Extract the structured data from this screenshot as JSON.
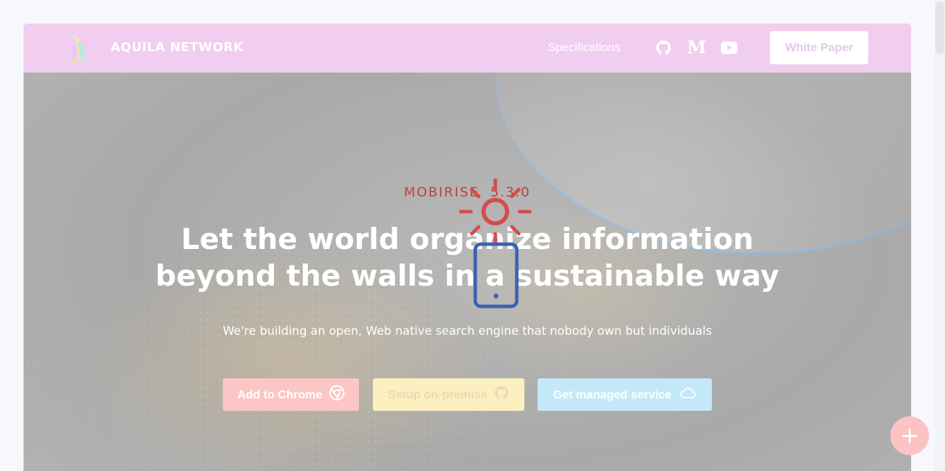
{
  "navbar": {
    "brand": "AQUILA NETWORK",
    "links": [
      {
        "label": "Specifications"
      }
    ],
    "icons": [
      "github-icon",
      "medium-icon",
      "youtube-icon"
    ],
    "medium_glyph": "M",
    "cta_label": "White Paper",
    "background": "#f1cdef"
  },
  "hero": {
    "eyebrow": "MOBIRISE  5.3.0",
    "title_line1": "Let the world organize information",
    "title_line2": "beyond the walls in a sustainable way",
    "subtitle": "We're building an open, Web native search engine that nobody own but individuals",
    "buttons": [
      {
        "label": "Add to Chrome",
        "icon": "chrome-icon",
        "color": "#fbc6c6"
      },
      {
        "label": "Setup on-premise",
        "icon": "github-icon",
        "color": "#fcefc0"
      },
      {
        "label": "Get managed service",
        "icon": "cloud-icon",
        "color": "#c5e8f8"
      }
    ]
  },
  "overlay": {
    "icons": [
      "sun-icon",
      "mobile-phone-icon"
    ]
  },
  "fab": {
    "label": "+",
    "color": "#fdc3c3"
  },
  "colors": {
    "eyebrow": "#c44040",
    "page_background": "#f6f8fc"
  }
}
